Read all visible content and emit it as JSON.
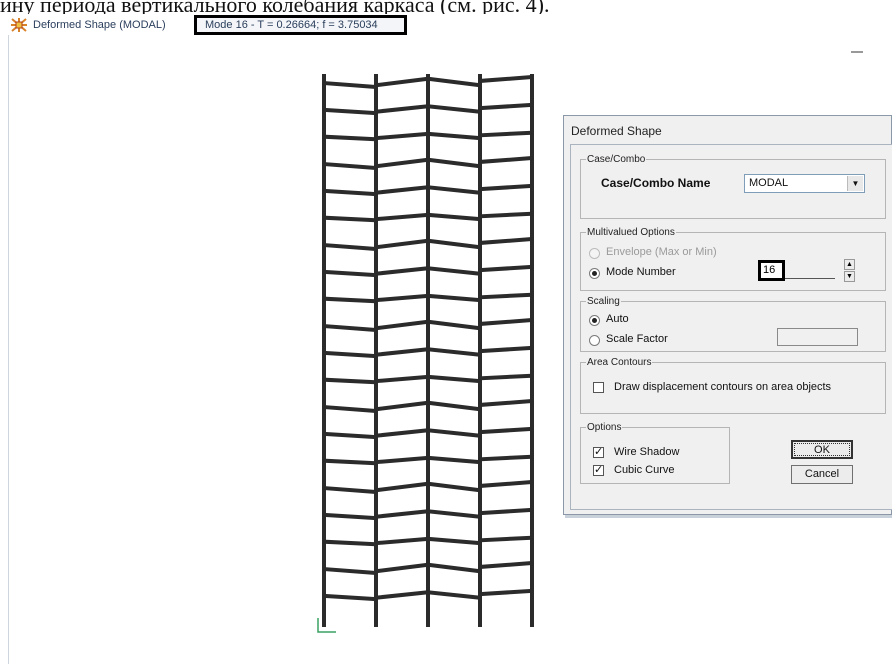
{
  "document": {
    "text_line": "ину периода вертикального колебания каркаса (см. рис. 4)."
  },
  "window": {
    "title": "Deformed Shape (MODAL)",
    "mode_info": "Mode 16 - T = 0.26664;  f = 3.75034",
    "icon": "sap-app-icon"
  },
  "viewport": {
    "frame": {
      "stories": 20,
      "bays": 4
    }
  },
  "dialog": {
    "title": "Deformed Shape",
    "case_combo": {
      "legend": "Case/Combo",
      "name_label": "Case/Combo Name",
      "name_value": "MODAL"
    },
    "multivalued": {
      "legend": "Multivalued Options",
      "envelope_label": "Envelope (Max or Min)",
      "mode_number_label": "Mode Number",
      "mode_number_value": "16",
      "selected": "Mode Number"
    },
    "scaling": {
      "legend": "Scaling",
      "auto_label": "Auto",
      "scale_factor_label": "Scale Factor",
      "scale_factor_value": "",
      "selected": "Auto"
    },
    "area_contours": {
      "legend": "Area Contours",
      "draw_label": "Draw displacement contours on area objects",
      "draw_checked": false
    },
    "options": {
      "legend": "Options",
      "wire_shadow_label": "Wire Shadow",
      "wire_shadow_checked": true,
      "cubic_curve_label": "Cubic Curve",
      "cubic_curve_checked": true
    },
    "ok_label": "OK",
    "cancel_label": "Cancel"
  },
  "colors": {
    "frame": "#2b2b2b",
    "dialog_bg": "#f0f0f0",
    "title_text": "#2a3e5c"
  }
}
